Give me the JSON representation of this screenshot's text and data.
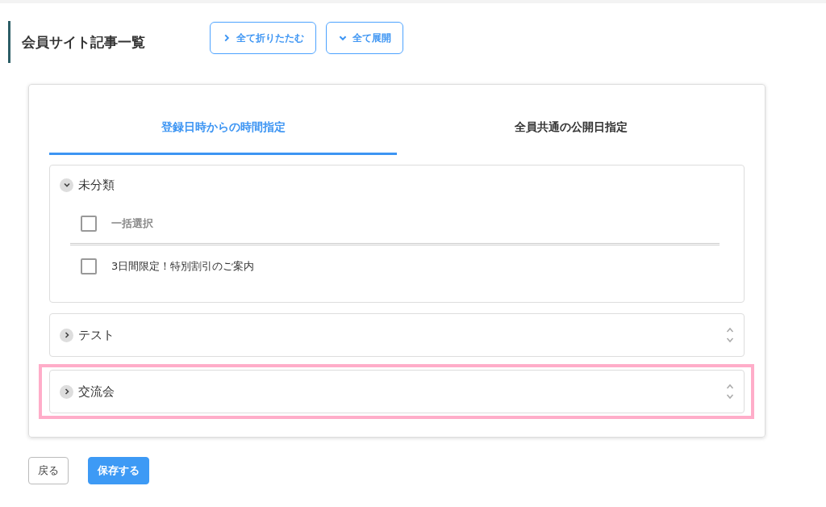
{
  "page_title": "会員サイト記事一覧",
  "header_buttons": [
    {
      "label": "全て折りたたむ",
      "kind": "collapse"
    },
    {
      "label": "全て展開",
      "kind": "expand"
    }
  ],
  "tabs": [
    {
      "label": "登録日時からの時間指定",
      "selected": true
    },
    {
      "label": "全員共通の公開日指定",
      "selected": false
    }
  ],
  "categories": [
    {
      "name": "未分類",
      "expanded": true,
      "highlighted": false,
      "items": [
        {
          "kind": "select-all",
          "label": "一括選択",
          "checked": false
        },
        {
          "kind": "article",
          "label": "3日間限定！特別割引のご案内",
          "checked": false
        }
      ]
    },
    {
      "name": "テスト",
      "expanded": false,
      "highlighted": false
    },
    {
      "name": "交流会",
      "expanded": false,
      "highlighted": true
    }
  ],
  "footer_buttons": [
    {
      "label": "戻る",
      "kind": "secondary"
    },
    {
      "label": "保存する",
      "kind": "primary"
    }
  ]
}
